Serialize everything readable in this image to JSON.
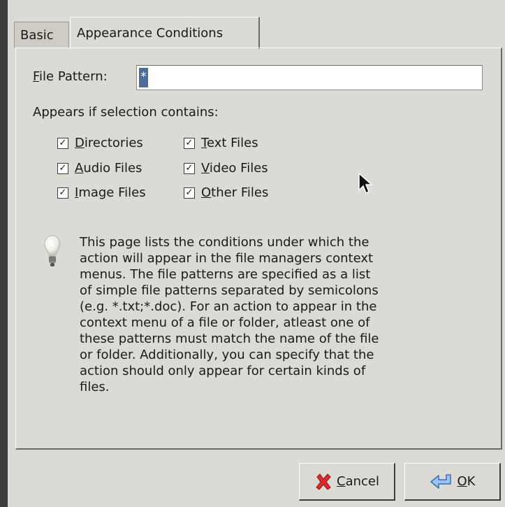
{
  "tabs": [
    {
      "label": "Basic",
      "active": false
    },
    {
      "label": "Appearance Conditions",
      "active": true
    }
  ],
  "file_pattern": {
    "label_mnemonic": "F",
    "label_rest": "ile Pattern:",
    "value": "*"
  },
  "appears_label": "Appears if selection contains:",
  "checkboxes": [
    {
      "mnemonic": "D",
      "rest": "irectories",
      "checked": true
    },
    {
      "mnemonic": "T",
      "rest": "ext Files",
      "checked": true
    },
    {
      "mnemonic": "A",
      "rest": "udio Files",
      "checked": true
    },
    {
      "mnemonic": "V",
      "rest": "ideo Files",
      "checked": true
    },
    {
      "mnemonic": "I",
      "rest": "mage Files",
      "checked": true
    },
    {
      "mnemonic": "O",
      "rest": "ther Files",
      "checked": true
    }
  ],
  "checkmark": "✓",
  "hint_text": "This page lists the conditions under which the\naction will appear in the file managers context\nmenus. The file patterns are specified as a list\nof simple file patterns separated by semicolons\n(e.g. *.txt;*.doc). For an action to appear in the\ncontext menu of a file or folder, atleast one of\nthese patterns must match the name of the file\nor folder. Additionally, you can specify that the\naction should only appear for certain kinds of\nfiles.",
  "buttons": {
    "cancel": {
      "mnemonic": "C",
      "rest": "ancel"
    },
    "ok": {
      "mnemonic": "O",
      "rest": "K"
    }
  },
  "colors": {
    "window_bg": "#dcdad5",
    "selection": "#4b6e99",
    "cancel_icon": "#d92b2b",
    "ok_icon": "#3a6fb5"
  }
}
